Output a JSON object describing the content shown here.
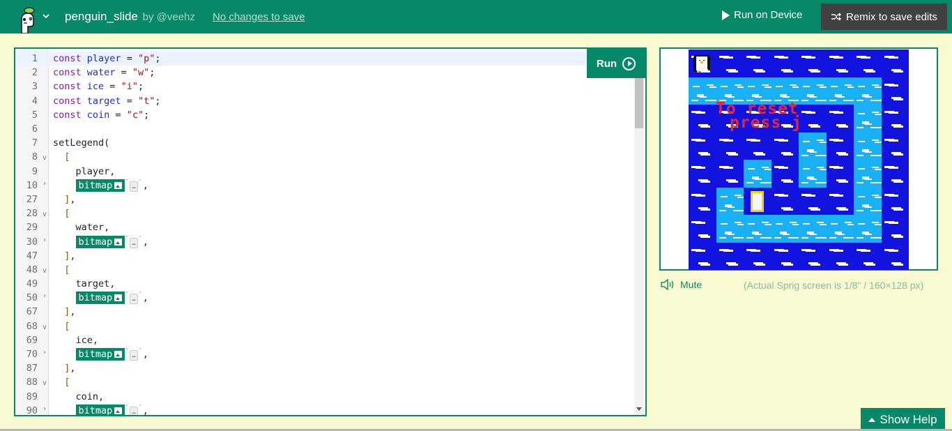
{
  "header": {
    "project_name": "penguin_slide",
    "author": "by @veehz",
    "save_status": "No changes to save",
    "run_on_device_label": "Run on Device",
    "remix_label": "Remix to save edits"
  },
  "editor": {
    "run_label": "Run",
    "lines": [
      {
        "n": "1",
        "fold": "",
        "active": true,
        "tokens": [
          {
            "c": "kw",
            "t": "const "
          },
          {
            "c": "var",
            "t": "player"
          },
          {
            "c": "",
            "t": " = "
          },
          {
            "c": "str",
            "t": "\"p\""
          },
          {
            "c": "",
            "t": ";"
          }
        ]
      },
      {
        "n": "2",
        "fold": "",
        "tokens": [
          {
            "c": "kw",
            "t": "const "
          },
          {
            "c": "var",
            "t": "water"
          },
          {
            "c": "",
            "t": " = "
          },
          {
            "c": "str",
            "t": "\"w\""
          },
          {
            "c": "",
            "t": ";"
          }
        ]
      },
      {
        "n": "3",
        "fold": "",
        "tokens": [
          {
            "c": "kw",
            "t": "const "
          },
          {
            "c": "var",
            "t": "ice"
          },
          {
            "c": "",
            "t": " = "
          },
          {
            "c": "str",
            "t": "\"i\""
          },
          {
            "c": "",
            "t": ";"
          }
        ]
      },
      {
        "n": "4",
        "fold": "",
        "tokens": [
          {
            "c": "kw",
            "t": "const "
          },
          {
            "c": "var",
            "t": "target"
          },
          {
            "c": "",
            "t": " = "
          },
          {
            "c": "str",
            "t": "\"t\""
          },
          {
            "c": "",
            "t": ";"
          }
        ]
      },
      {
        "n": "5",
        "fold": "",
        "tokens": [
          {
            "c": "kw",
            "t": "const "
          },
          {
            "c": "var",
            "t": "coin"
          },
          {
            "c": "",
            "t": " = "
          },
          {
            "c": "str",
            "t": "\"c\""
          },
          {
            "c": "",
            "t": ";"
          }
        ]
      },
      {
        "n": "6",
        "fold": "",
        "tokens": []
      },
      {
        "n": "7",
        "fold": "",
        "tokens": [
          {
            "c": "",
            "t": "setLegend("
          }
        ]
      },
      {
        "n": "8",
        "fold": "down",
        "tokens": [
          {
            "c": "br",
            "t": "  ["
          }
        ]
      },
      {
        "n": "9",
        "fold": "",
        "tokens": [
          {
            "c": "",
            "t": "    player,"
          }
        ]
      },
      {
        "n": "10",
        "fold": "right",
        "bitmap": true
      },
      {
        "n": "27",
        "fold": "",
        "tokens": [
          {
            "c": "br",
            "t": "  ]"
          },
          {
            "c": "",
            "t": ","
          }
        ]
      },
      {
        "n": "28",
        "fold": "down",
        "tokens": [
          {
            "c": "br",
            "t": "  ["
          }
        ]
      },
      {
        "n": "29",
        "fold": "",
        "tokens": [
          {
            "c": "",
            "t": "    water,"
          }
        ]
      },
      {
        "n": "30",
        "fold": "right",
        "bitmap": true
      },
      {
        "n": "47",
        "fold": "",
        "tokens": [
          {
            "c": "br",
            "t": "  ]"
          },
          {
            "c": "",
            "t": ","
          }
        ]
      },
      {
        "n": "48",
        "fold": "down",
        "tokens": [
          {
            "c": "br",
            "t": "  ["
          }
        ]
      },
      {
        "n": "49",
        "fold": "",
        "tokens": [
          {
            "c": "",
            "t": "    target,"
          }
        ]
      },
      {
        "n": "50",
        "fold": "right",
        "bitmap": true
      },
      {
        "n": "67",
        "fold": "",
        "tokens": [
          {
            "c": "br",
            "t": "  ]"
          },
          {
            "c": "",
            "t": ","
          }
        ]
      },
      {
        "n": "68",
        "fold": "down",
        "tokens": [
          {
            "c": "br",
            "t": "  ["
          }
        ]
      },
      {
        "n": "69",
        "fold": "",
        "tokens": [
          {
            "c": "",
            "t": "    ice,"
          }
        ]
      },
      {
        "n": "70",
        "fold": "right",
        "bitmap": true
      },
      {
        "n": "87",
        "fold": "",
        "tokens": [
          {
            "c": "br",
            "t": "  ]"
          },
          {
            "c": "",
            "t": ","
          }
        ]
      },
      {
        "n": "88",
        "fold": "down",
        "tokens": [
          {
            "c": "br",
            "t": "  ["
          }
        ]
      },
      {
        "n": "89",
        "fold": "",
        "tokens": [
          {
            "c": "",
            "t": "    coin,"
          }
        ]
      },
      {
        "n": "90",
        "fold": "right",
        "bitmap": true
      }
    ],
    "bitmap_label": "bitmap",
    "collapsed_placeholder": "…"
  },
  "game": {
    "map": [
      "pwwwwwww",
      "iiiiiiiw",
      "wwwwwwiw",
      "wwwwiwiw",
      "wwiwiwiw",
      "witwwwiw",
      "wiiiiiiw",
      "wwwwwwww"
    ],
    "overlay_text": [
      "To reset",
      "press j"
    ],
    "colors": {
      "water": "#1313e0",
      "ice": "#1ab0f4",
      "text": "#e0283c",
      "target_border": "#f5d20b"
    }
  },
  "footer": {
    "mute_label": "Mute",
    "screen_note": "(Actual Sprig screen is 1/8\" / 160×128 px)",
    "help_label": "Show Help"
  },
  "theme": {
    "brand": "#078969",
    "background": "#fafad2",
    "remix_bg": "#414141"
  }
}
